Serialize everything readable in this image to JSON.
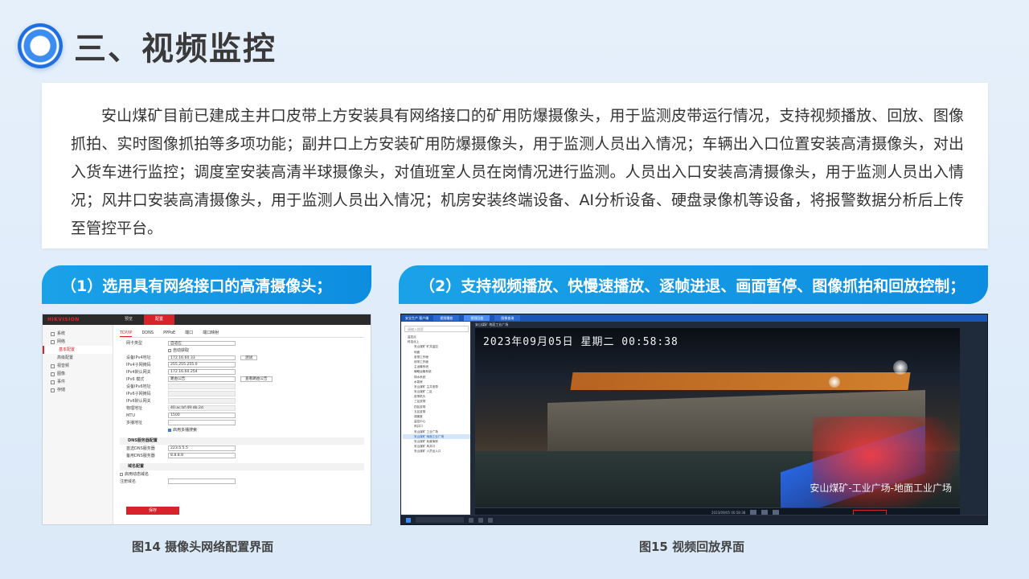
{
  "title": "三、视频监控",
  "intro": "安山煤矿目前已建成主井口皮带上方安装具有网络接口的矿用防爆摄像头，用于监测皮带运行情况，支持视频播放、回放、图像抓拍、实时图像抓拍等多项功能；副井口上方安装矿用防爆摄像头，用于监测人员出入情况；车辆出入口位置安装高清摄像头，对出入货车进行监控；调度室安装高清半球摄像头，对值班室人员在岗情况进行监测。人员出入口安装高清摄像头，用于监测人员出入情况；风井口安装高清摄像头，用于监测人员出入情况；机房安装终端设备、AI分析设备、硬盘录像机等设备，将报警数据分析后上传至管控平台。",
  "sections": {
    "left_header": "（1）选用具有网络接口的高清摄像头；",
    "right_header": "（2）支持视频播放、快慢速播放、逐帧进退、画面暂停、图像抓拍和回放控制；",
    "left_caption": "图14 摄像头网络配置界面",
    "right_caption": "图15 视频回放界面"
  },
  "camera_config": {
    "logo_brand": "HIKVISION",
    "top_tabs": [
      "预览",
      "配置"
    ],
    "side_items": [
      "系统",
      "网络",
      "基本配置",
      "高级配置",
      "视音频",
      "图像",
      "事件",
      "存储"
    ],
    "form_tabs": [
      "TCP/IP",
      "DDNS",
      "PPPoE",
      "端口",
      "端口映射"
    ],
    "fields": [
      {
        "label": "网卡类型",
        "value": "自适应"
      },
      {
        "label": "",
        "value": "自动获取"
      },
      {
        "label": "设备IPv4地址",
        "value": "172.16.60.33"
      },
      {
        "label": "IPv4子网掩码",
        "value": "255.255.255.0"
      },
      {
        "label": "IPv4默认网关",
        "value": "172.16.60.254"
      },
      {
        "label": "IPv6 模式",
        "value": "路由公告"
      },
      {
        "label": "设备IPv6地址",
        "value": ""
      },
      {
        "label": "IPv6子网掩码",
        "value": ""
      },
      {
        "label": "IPv6默认网关",
        "value": ""
      },
      {
        "label": "物理地址",
        "value": "40:ac:bf:49:db:2d"
      },
      {
        "label": "MTU",
        "value": "1500"
      },
      {
        "label": "多播地址",
        "value": ""
      }
    ],
    "test_button": "测试",
    "route_button": "查看路由公告",
    "multicast_check": "启用多播搜索",
    "dns_section": "DNS服务器配置",
    "dns_fields": [
      {
        "label": "首选DNS服务器",
        "value": "223.5.5.5"
      },
      {
        "label": "备用DNS服务器",
        "value": "8.8.8.8"
      }
    ],
    "domain_section": "域名配置",
    "domain_check": "启用动态域名",
    "domain_label": "注册域名",
    "save_button": "保存"
  },
  "playback": {
    "top_tabs": [
      "安全生产 客户端",
      "视频播放",
      "视频回放",
      "图像查询"
    ],
    "search_placeholder": "请输入搜索",
    "tree": [
      "监控点",
      "科技北上",
      "安山煤矿 矿井监控",
      "地面",
      "皮带工作面",
      "综采工作面",
      "主运输系统",
      "辅助运输系统",
      "排水系统",
      "水泵房",
      "安山煤矿 主井皮带",
      "安山煤矿 二区",
      "皮带机头",
      "三区皮带",
      "四区皮带",
      "五区皮带",
      "调度室",
      "监控中心",
      "风井口",
      "安山煤矿 工业广场",
      "安山煤矿 地面工业广场",
      "安山煤矿 危废库房",
      "安山煤矿 风井口",
      "安山煤矿 人员出入口"
    ],
    "selected_index": 20,
    "osd_time": "2023年09月05日 星期二 00:58:38",
    "osd_location": "安山煤矿-工业广场-地面工业广场",
    "camera_title": "安山煤矿 地面工业广场",
    "timeline_time": "2023/09/05 00:58:38"
  }
}
